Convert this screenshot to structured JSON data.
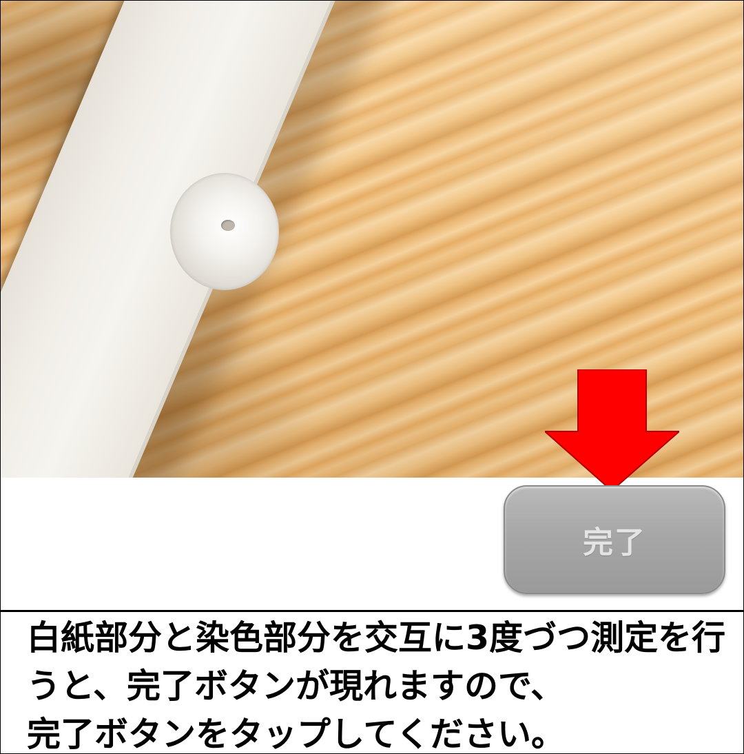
{
  "scene": {
    "strip_icon": "test-strip-icon",
    "sample_icon": "sample-spot-icon",
    "arrow_icon": "down-arrow-icon",
    "arrow_color": "#ff0000"
  },
  "button": {
    "label": "完了",
    "color": "#a8a8a8"
  },
  "instruction": {
    "lines": [
      "白紙部分と染色部分を交互に3度づつ測定を行",
      "うと、完了ボタンが現れますので、",
      "完了ボタンをタップしてください。"
    ]
  }
}
